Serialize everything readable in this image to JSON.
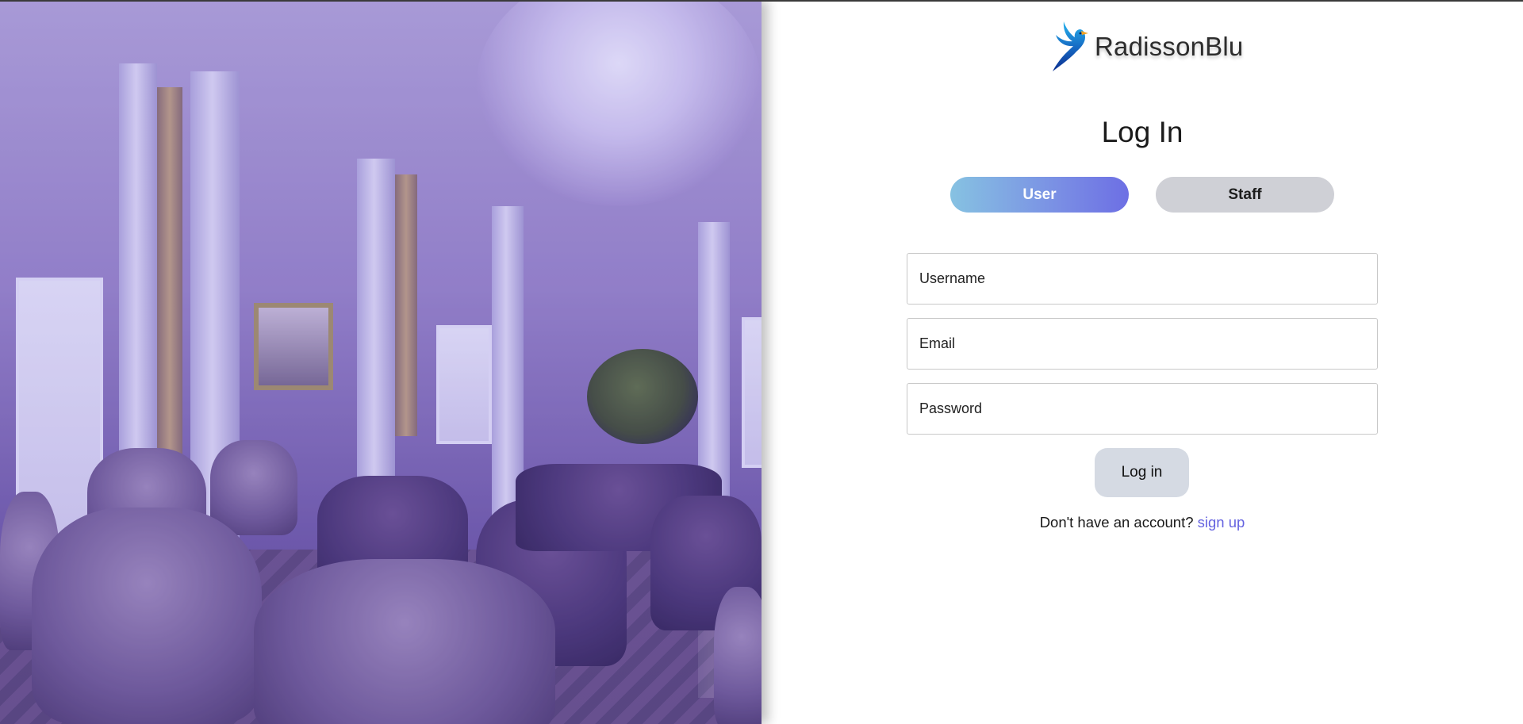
{
  "brand": {
    "name": "RadissonBlu",
    "logo_icon": "bird-logo-icon",
    "logo_colors": [
      "#1fa7e6",
      "#1565c0",
      "#0d2f8f"
    ]
  },
  "login": {
    "title": "Log In",
    "roles": {
      "user_label": "User",
      "staff_label": "Staff",
      "selected": "User"
    },
    "fields": {
      "username_placeholder": "Username",
      "email_placeholder": "Email",
      "password_placeholder": "Password"
    },
    "submit_label": "Log in",
    "signup_prompt": "Don't have an account?",
    "signup_link": "sign up"
  },
  "theme": {
    "accent": "#6d6fe4",
    "accent_light": "#86c2e2",
    "link": "#6563e0",
    "hero_tint": "#6a5cd2"
  }
}
